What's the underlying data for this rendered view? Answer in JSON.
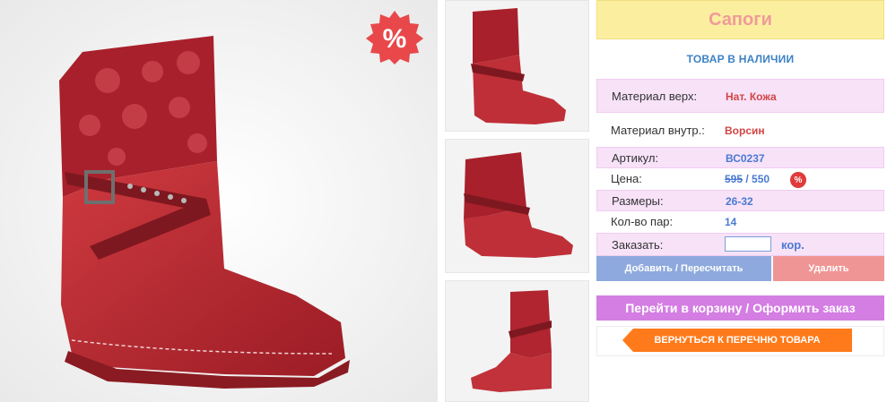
{
  "product": {
    "title": "Сапоги",
    "stock_status": "ТОВАР В НАЛИЧИИ",
    "sale_badge": "%"
  },
  "specs": {
    "material_top_label": "Материал верх:",
    "material_top_value": "Нат. Кожа",
    "material_inner_label": "Материал внутр.:",
    "material_inner_value": "Ворсин",
    "article_label": "Артикул:",
    "article_value": "ВС0237",
    "price_label": "Цена:",
    "price_old": "595",
    "price_sep": " / ",
    "price_new": "550",
    "discount_icon": "%",
    "sizes_label": "Размеры:",
    "sizes_value": "26-32",
    "pairs_label": "Кол-во пар:",
    "pairs_value": "14",
    "order_label": "Заказать:",
    "order_input_value": "",
    "order_unit": "кор."
  },
  "actions": {
    "add_label": "Добавить / Пересчитать",
    "delete_label": "Удалить",
    "cart_label": "Перейти в корзину / Оформить заказ",
    "back_label": "ВЕРНУТЬСЯ К ПЕРЕЧНЮ ТОВАРА"
  },
  "colors": {
    "title_bg": "#fbef9f",
    "accent_pink": "#f7e2f8",
    "add_button": "#8ea9dd",
    "delete_button": "#f09595",
    "cart_button": "#d47de3",
    "back_button": "#ff7a1a",
    "boot_red": "#b8262e"
  }
}
